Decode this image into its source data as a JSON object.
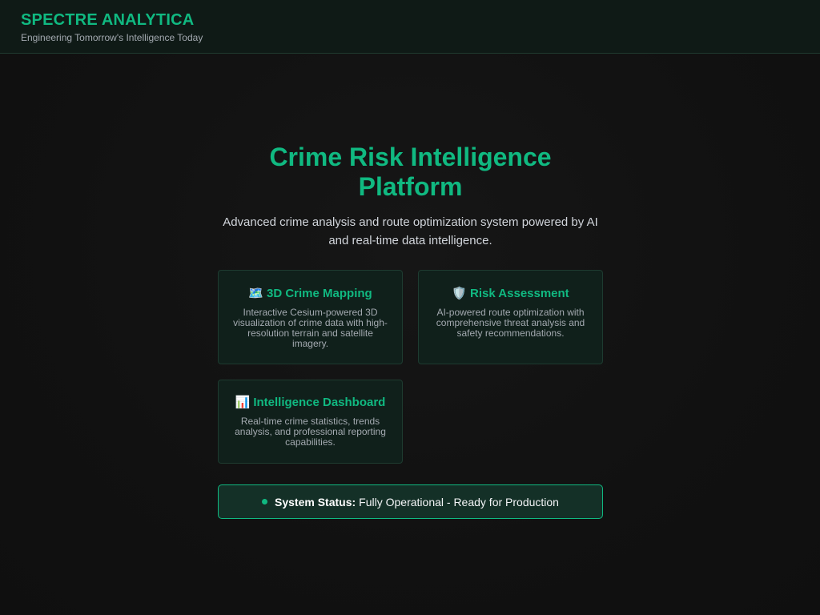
{
  "header": {
    "brand": "SPECTRE ANALYTICA",
    "tagline": "Engineering Tomorrow's Intelligence Today"
  },
  "hero": {
    "title": "Crime Risk Intelligence Platform",
    "subtitle": "Advanced crime analysis and route optimization system powered by AI and real-time data intelligence."
  },
  "features": [
    {
      "icon": "map-icon",
      "emoji": "🗺️",
      "title": "3D Crime Mapping",
      "description": "Interactive Cesium-powered 3D visualization of crime data with high-resolution terrain and satellite imagery."
    },
    {
      "icon": "shield-icon",
      "emoji": "🛡️",
      "title": "Risk Assessment",
      "description": "AI-powered route optimization with comprehensive threat analysis and safety recommendations."
    },
    {
      "icon": "bar-chart-icon",
      "emoji": "📊",
      "title": "Intelligence Dashboard",
      "description": "Real-time crime statistics, trends analysis, and professional reporting capabilities."
    }
  ],
  "status": {
    "label": "System Status:",
    "value": "Fully Operational - Ready for Production"
  },
  "colors": {
    "accent": "#10b981",
    "background": "#121212",
    "card_background": "#10201b",
    "header_background": "#0f1a16"
  }
}
